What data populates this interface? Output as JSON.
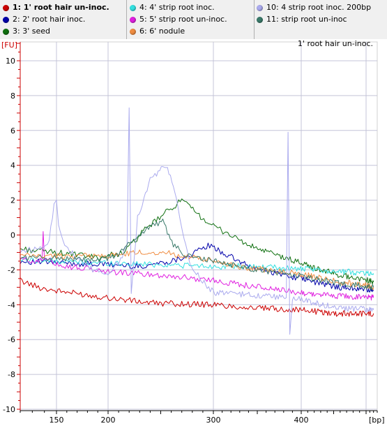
{
  "legend": {
    "items": [
      {
        "label": "1: 1' root hair un-inoc.",
        "color": "#cc0000"
      },
      {
        "label": "2: 2' root hair inoc.",
        "color": "#0000aa"
      },
      {
        "label": "3: 3' seed",
        "color": "#107010"
      },
      {
        "label": "4: 4' strip root inoc.",
        "color": "#33e0e0"
      },
      {
        "label": "5: 5' strip root un-inoc.",
        "color": "#e020e0"
      },
      {
        "label": "6: 6' nodule",
        "color": "#f08c40"
      },
      {
        "label": "10: 4 strip root inoc. 200bp",
        "color": "#aaaaee"
      },
      {
        "label": "11: strip root un-inoc",
        "color": "#3a7a6a"
      }
    ]
  },
  "chart_data": {
    "type": "line",
    "title": "1' root hair un-inoc.",
    "ylabel": "[FU]",
    "xlabel": "[bp]",
    "ylim": [
      -10,
      11
    ],
    "yticks": [
      -10,
      -8,
      -6,
      -4,
      -2,
      0,
      2,
      4,
      6,
      8,
      10
    ],
    "x_axis": {
      "tick_labels": [
        {
          "label": "150",
          "bp": 150
        },
        {
          "label": "200",
          "bp": 200
        },
        {
          "label": "300",
          "bp": 300
        },
        {
          "label": "400",
          "bp": 400
        }
      ],
      "gridline_bp": [
        150,
        200,
        300,
        400,
        500
      ]
    },
    "series": [
      {
        "name": "1: 1' root hair un-inoc.",
        "color": "#cc0000",
        "points": [
          [
            120,
            -2.6
          ],
          [
            135,
            -3.0
          ],
          [
            150,
            -3.2
          ],
          [
            175,
            -3.4
          ],
          [
            200,
            -3.6
          ],
          [
            240,
            -3.9
          ],
          [
            300,
            -4.0
          ],
          [
            350,
            -4.2
          ],
          [
            400,
            -4.3
          ],
          [
            450,
            -4.5
          ],
          [
            520,
            -4.5
          ]
        ]
      },
      {
        "name": "2: 2' root hair inoc.",
        "color": "#0000aa",
        "points": [
          [
            120,
            -1.5
          ],
          [
            150,
            -1.6
          ],
          [
            200,
            -1.7
          ],
          [
            230,
            -1.8
          ],
          [
            260,
            -1.5
          ],
          [
            280,
            -1.1
          ],
          [
            295,
            -0.6
          ],
          [
            310,
            -1.0
          ],
          [
            340,
            -1.8
          ],
          [
            380,
            -2.3
          ],
          [
            420,
            -2.7
          ],
          [
            460,
            -3.0
          ],
          [
            520,
            -3.2
          ]
        ]
      },
      {
        "name": "3: 3' seed",
        "color": "#107010",
        "points": [
          [
            120,
            -0.8
          ],
          [
            150,
            -1.0
          ],
          [
            190,
            -1.3
          ],
          [
            215,
            -1.0
          ],
          [
            235,
            0.3
          ],
          [
            255,
            1.3
          ],
          [
            270,
            2.0
          ],
          [
            285,
            1.2
          ],
          [
            300,
            0.5
          ],
          [
            320,
            0.0
          ],
          [
            340,
            -0.6
          ],
          [
            380,
            -1.3
          ],
          [
            420,
            -1.9
          ],
          [
            460,
            -2.3
          ],
          [
            520,
            -2.7
          ]
        ]
      },
      {
        "name": "4: 4' strip root inoc.",
        "color": "#33e0e0",
        "points": [
          [
            120,
            -1.4
          ],
          [
            150,
            -1.5
          ],
          [
            200,
            -1.6
          ],
          [
            250,
            -1.7
          ],
          [
            300,
            -1.8
          ],
          [
            340,
            -1.8
          ],
          [
            380,
            -1.9
          ],
          [
            420,
            -2.0
          ],
          [
            460,
            -2.1
          ],
          [
            520,
            -2.2
          ]
        ]
      },
      {
        "name": "5: 5' strip root un-inoc.",
        "color": "#e020e0",
        "points": [
          [
            120,
            -1.4
          ],
          [
            138,
            -1.5
          ],
          [
            139,
            0.2
          ],
          [
            140,
            -1.4
          ],
          [
            160,
            -1.8
          ],
          [
            200,
            -2.1
          ],
          [
            250,
            -2.3
          ],
          [
            300,
            -2.6
          ],
          [
            340,
            -2.9
          ],
          [
            380,
            -3.2
          ],
          [
            420,
            -3.4
          ],
          [
            460,
            -3.5
          ],
          [
            520,
            -3.6
          ]
        ]
      },
      {
        "name": "6: 6' nodule",
        "color": "#f08c40",
        "points": [
          [
            120,
            -1.2
          ],
          [
            150,
            -1.2
          ],
          [
            200,
            -1.2
          ],
          [
            230,
            -1.0
          ],
          [
            255,
            -1.0
          ],
          [
            280,
            -1.3
          ],
          [
            310,
            -1.6
          ],
          [
            340,
            -1.9
          ],
          [
            380,
            -2.1
          ],
          [
            420,
            -2.4
          ],
          [
            460,
            -2.7
          ],
          [
            520,
            -3.0
          ]
        ]
      },
      {
        "name": "10: 4 strip root inoc. 200bp",
        "color": "#aaaaee",
        "points": [
          [
            120,
            -0.9
          ],
          [
            135,
            -0.8
          ],
          [
            144,
            -0.3
          ],
          [
            148,
            1.8
          ],
          [
            150,
            2.0
          ],
          [
            152,
            0.6
          ],
          [
            158,
            -0.5
          ],
          [
            170,
            -1.4
          ],
          [
            185,
            -2.0
          ],
          [
            200,
            -2.2
          ],
          [
            212,
            -1.4
          ],
          [
            218,
            -0.6
          ],
          [
            220,
            7.3
          ],
          [
            222,
            -3.2
          ],
          [
            228,
            1.0
          ],
          [
            240,
            3.2
          ],
          [
            255,
            4.0
          ],
          [
            262,
            2.8
          ],
          [
            268,
            1.0
          ],
          [
            278,
            -1.8
          ],
          [
            300,
            -3.3
          ],
          [
            330,
            -3.4
          ],
          [
            360,
            -3.5
          ],
          [
            383,
            -3.6
          ],
          [
            385,
            5.9
          ],
          [
            387,
            -5.7
          ],
          [
            390,
            -3.6
          ],
          [
            420,
            -3.9
          ],
          [
            460,
            -4.2
          ],
          [
            520,
            -4.3
          ]
        ]
      },
      {
        "name": "11: strip root un-inoc",
        "color": "#3a7a6a",
        "points": [
          [
            120,
            -1.3
          ],
          [
            150,
            -1.3
          ],
          [
            190,
            -1.5
          ],
          [
            210,
            -1.1
          ],
          [
            225,
            -0.2
          ],
          [
            240,
            0.5
          ],
          [
            252,
            0.8
          ],
          [
            262,
            -0.6
          ],
          [
            275,
            -1.2
          ],
          [
            300,
            -1.5
          ],
          [
            340,
            -1.9
          ],
          [
            380,
            -2.2
          ],
          [
            420,
            -2.5
          ],
          [
            460,
            -2.8
          ],
          [
            520,
            -3.0
          ]
        ]
      }
    ]
  }
}
